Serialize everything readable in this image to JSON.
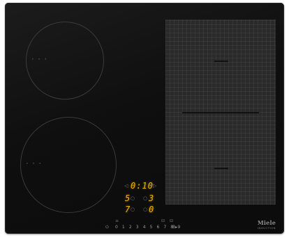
{
  "brand": {
    "name": "Miele",
    "subtitle": "INDUCTION"
  },
  "zones": {
    "top_left_dots": "• • •",
    "bottom_left_dots": "• • •"
  },
  "display": {
    "timer_value": "0:10",
    "level_1": "5",
    "level_2": "3",
    "level_3": "7",
    "level_4": "0"
  },
  "controls": {
    "power_symbol": "⏻",
    "power_scale": "0 1 2 3 4 5 6 7 8 9",
    "boost_symbol": "B▸",
    "timer_icon_left": "◁",
    "timer_icon_right": "▷",
    "zone_icon": "○",
    "small_icon": "≡",
    "keep_warm_icon": "⊟"
  },
  "colors": {
    "display_digit": "#f2b200",
    "glass": "#111111",
    "flex_zone": "#2a2a2a"
  },
  "icons": [
    "power-icon",
    "timer-icon",
    "zone-selector-icon",
    "boost-icon",
    "stop-go-icon",
    "keep-warm-icon"
  ]
}
